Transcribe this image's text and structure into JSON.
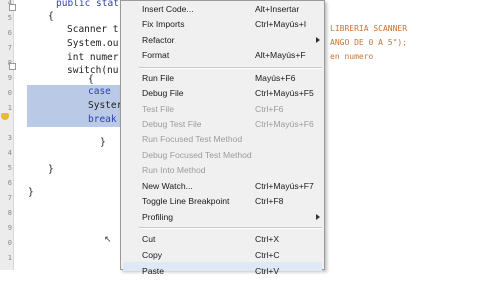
{
  "editor": {
    "code_lines": [
      "public stat",
      "{",
      "Scanner t",
      "System.ou",
      "int numer",
      "switch(nu",
      "{",
      "case",
      "Syster",
      "break",
      "}",
      "}",
      "}"
    ],
    "comment_lines": [
      "LIBRERIA SCANNER",
      "ANGO DE 0 A 5\");",
      "en numero"
    ]
  },
  "context_menu": {
    "items": [
      {
        "label": "Insert Code...",
        "shortcut": "Alt+Insertar",
        "enabled": true
      },
      {
        "label": "Fix Imports",
        "shortcut": "Ctrl+Mayús+I",
        "enabled": true
      },
      {
        "label": "Refactor",
        "shortcut": "",
        "enabled": true,
        "submenu": true
      },
      {
        "label": "Format",
        "shortcut": "Alt+Mayús+F",
        "enabled": true
      },
      {
        "label": "Run File",
        "shortcut": "Mayús+F6",
        "enabled": true
      },
      {
        "label": "Debug File",
        "shortcut": "Ctrl+Mayús+F5",
        "enabled": true
      },
      {
        "label": "Test File",
        "shortcut": "Ctrl+F6",
        "enabled": false
      },
      {
        "label": "Debug Test File",
        "shortcut": "Ctrl+Mayús+F6",
        "enabled": false
      },
      {
        "label": "Run Focused Test Method",
        "shortcut": "",
        "enabled": false
      },
      {
        "label": "Debug Focused Test Method",
        "shortcut": "",
        "enabled": false
      },
      {
        "label": "Run Into Method",
        "shortcut": "",
        "enabled": false
      },
      {
        "label": "New Watch...",
        "shortcut": "Ctrl+Mayús+F7",
        "enabled": true
      },
      {
        "label": "Toggle Line Breakpoint",
        "shortcut": "Ctrl+F8",
        "enabled": true
      },
      {
        "label": "Profiling",
        "shortcut": "",
        "enabled": true,
        "submenu": true
      },
      {
        "label": "Cut",
        "shortcut": "Ctrl+X",
        "enabled": true
      },
      {
        "label": "Copy",
        "shortcut": "Ctrl+C",
        "enabled": true
      },
      {
        "label": "Paste",
        "shortcut": "Ctrl+V",
        "enabled": true
      }
    ]
  }
}
